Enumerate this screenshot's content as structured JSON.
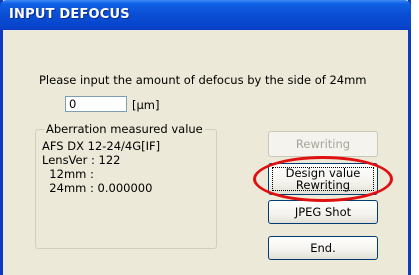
{
  "window": {
    "title": "INPUT DEFOCUS"
  },
  "prompt": {
    "text": "Please input the amount of defocus by the side of   24mm"
  },
  "defocus": {
    "value": "0",
    "unit": "[μm]"
  },
  "aberration": {
    "legend": "Aberration measured value",
    "lines": [
      "AFS DX 12-24/4G[IF]",
      "LensVer : 122",
      "  12mm :",
      "  24mm : 0.000000"
    ]
  },
  "buttons": {
    "rewriting": "Rewriting",
    "design_line1": "Design value",
    "design_line2": "Rewriting",
    "jpeg": "JPEG Shot",
    "end": "End."
  },
  "colors": {
    "annotation": "#e01010",
    "title_bar": "#0a4fd6"
  }
}
